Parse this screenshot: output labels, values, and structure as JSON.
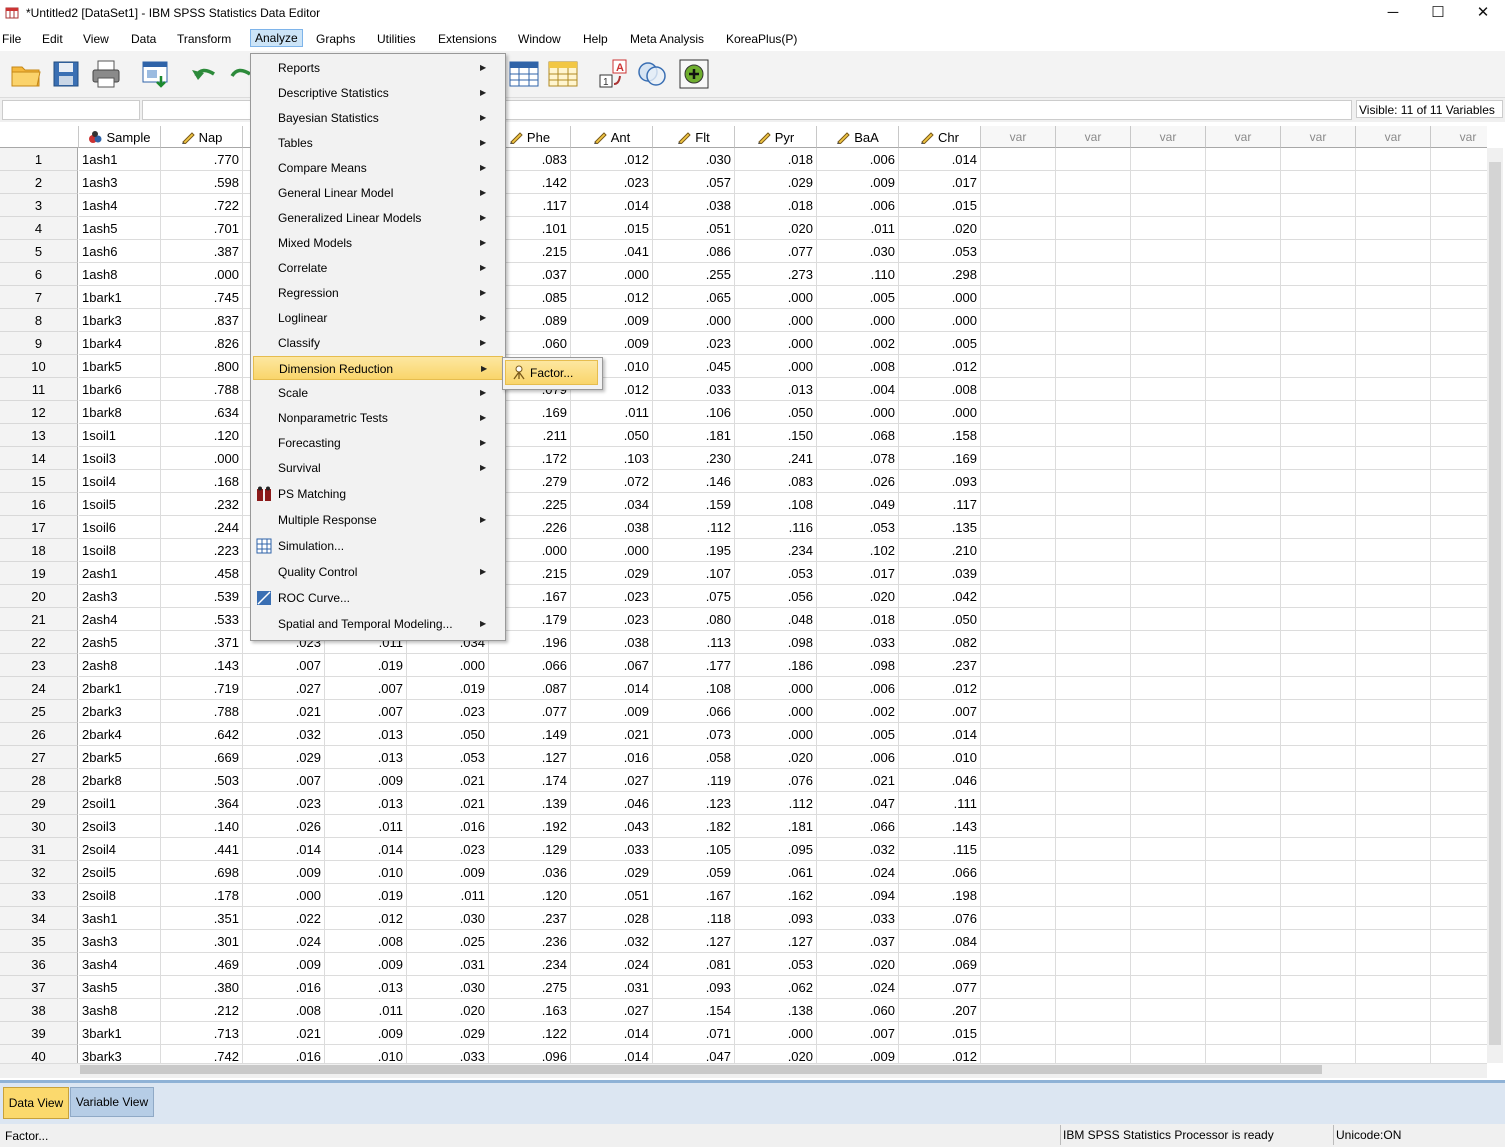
{
  "window": {
    "title": "*Untitled2 [DataSet1] - IBM SPSS Statistics Data Editor",
    "controls": [
      "─",
      "☐",
      "✕"
    ]
  },
  "menubar": [
    "File",
    "Edit",
    "View",
    "Data",
    "Transform",
    "Analyze",
    "Graphs",
    "Utilities",
    "Extensions",
    "Window",
    "Help",
    "Meta Analysis",
    "KoreaPlus(P)"
  ],
  "cellbar": {
    "visible_label": "Visible: 11 of 11 Variables"
  },
  "grid": {
    "columns": [
      "Sample",
      "Nap",
      "",
      "",
      "",
      "Phe",
      "Ant",
      "Flt",
      "Pyr",
      "BaA",
      "Chr"
    ],
    "var_label": "var",
    "rows": [
      [
        "1",
        "1ash1",
        ".770",
        "",
        "",
        "",
        ".083",
        ".012",
        ".030",
        ".018",
        ".006",
        ".014"
      ],
      [
        "2",
        "1ash3",
        ".598",
        "",
        "",
        "",
        ".142",
        ".023",
        ".057",
        ".029",
        ".009",
        ".017"
      ],
      [
        "3",
        "1ash4",
        ".722",
        "",
        "",
        "",
        ".117",
        ".014",
        ".038",
        ".018",
        ".006",
        ".015"
      ],
      [
        "4",
        "1ash5",
        ".701",
        "",
        "",
        "",
        ".101",
        ".015",
        ".051",
        ".020",
        ".011",
        ".020"
      ],
      [
        "5",
        "1ash6",
        ".387",
        "",
        "",
        "",
        ".215",
        ".041",
        ".086",
        ".077",
        ".030",
        ".053"
      ],
      [
        "6",
        "1ash8",
        ".000",
        "",
        "",
        "",
        ".037",
        ".000",
        ".255",
        ".273",
        ".110",
        ".298"
      ],
      [
        "7",
        "1bark1",
        ".745",
        "",
        "",
        "",
        ".085",
        ".012",
        ".065",
        ".000",
        ".005",
        ".000"
      ],
      [
        "8",
        "1bark3",
        ".837",
        "",
        "",
        "",
        ".089",
        ".009",
        ".000",
        ".000",
        ".000",
        ".000"
      ],
      [
        "9",
        "1bark4",
        ".826",
        "",
        "",
        "",
        ".060",
        ".009",
        ".023",
        ".000",
        ".002",
        ".005"
      ],
      [
        "10",
        "1bark5",
        ".800",
        "",
        "",
        "",
        "",
        ".010",
        ".045",
        ".000",
        ".008",
        ".012"
      ],
      [
        "11",
        "1bark6",
        ".788",
        "",
        "",
        "",
        ".079",
        ".012",
        ".033",
        ".013",
        ".004",
        ".008"
      ],
      [
        "12",
        "1bark8",
        ".634",
        "",
        "",
        "",
        ".169",
        ".011",
        ".106",
        ".050",
        ".000",
        ".000"
      ],
      [
        "13",
        "1soil1",
        ".120",
        "",
        "",
        "",
        ".211",
        ".050",
        ".181",
        ".150",
        ".068",
        ".158"
      ],
      [
        "14",
        "1soil3",
        ".000",
        "",
        "",
        "",
        ".172",
        ".103",
        ".230",
        ".241",
        ".078",
        ".169"
      ],
      [
        "15",
        "1soil4",
        ".168",
        "",
        "",
        "",
        ".279",
        ".072",
        ".146",
        ".083",
        ".026",
        ".093"
      ],
      [
        "16",
        "1soil5",
        ".232",
        "",
        "",
        "",
        ".225",
        ".034",
        ".159",
        ".108",
        ".049",
        ".117"
      ],
      [
        "17",
        "1soil6",
        ".244",
        "",
        "",
        "",
        ".226",
        ".038",
        ".112",
        ".116",
        ".053",
        ".135"
      ],
      [
        "18",
        "1soil8",
        ".223",
        "",
        "",
        "",
        ".000",
        ".000",
        ".195",
        ".234",
        ".102",
        ".210"
      ],
      [
        "19",
        "2ash1",
        ".458",
        "",
        "",
        "",
        ".215",
        ".029",
        ".107",
        ".053",
        ".017",
        ".039"
      ],
      [
        "20",
        "2ash3",
        ".539",
        "",
        "",
        "",
        ".167",
        ".023",
        ".075",
        ".056",
        ".020",
        ".042"
      ],
      [
        "21",
        "2ash4",
        ".533",
        "",
        "",
        "",
        ".179",
        ".023",
        ".080",
        ".048",
        ".018",
        ".050"
      ],
      [
        "22",
        "2ash5",
        ".371",
        ".023",
        ".011",
        ".034",
        ".196",
        ".038",
        ".113",
        ".098",
        ".033",
        ".082"
      ],
      [
        "23",
        "2ash8",
        ".143",
        ".007",
        ".019",
        ".000",
        ".066",
        ".067",
        ".177",
        ".186",
        ".098",
        ".237"
      ],
      [
        "24",
        "2bark1",
        ".719",
        ".027",
        ".007",
        ".019",
        ".087",
        ".014",
        ".108",
        ".000",
        ".006",
        ".012"
      ],
      [
        "25",
        "2bark3",
        ".788",
        ".021",
        ".007",
        ".023",
        ".077",
        ".009",
        ".066",
        ".000",
        ".002",
        ".007"
      ],
      [
        "26",
        "2bark4",
        ".642",
        ".032",
        ".013",
        ".050",
        ".149",
        ".021",
        ".073",
        ".000",
        ".005",
        ".014"
      ],
      [
        "27",
        "2bark5",
        ".669",
        ".029",
        ".013",
        ".053",
        ".127",
        ".016",
        ".058",
        ".020",
        ".006",
        ".010"
      ],
      [
        "28",
        "2bark8",
        ".503",
        ".007",
        ".009",
        ".021",
        ".174",
        ".027",
        ".119",
        ".076",
        ".021",
        ".046"
      ],
      [
        "29",
        "2soil1",
        ".364",
        ".023",
        ".013",
        ".021",
        ".139",
        ".046",
        ".123",
        ".112",
        ".047",
        ".111"
      ],
      [
        "30",
        "2soil3",
        ".140",
        ".026",
        ".011",
        ".016",
        ".192",
        ".043",
        ".182",
        ".181",
        ".066",
        ".143"
      ],
      [
        "31",
        "2soil4",
        ".441",
        ".014",
        ".014",
        ".023",
        ".129",
        ".033",
        ".105",
        ".095",
        ".032",
        ".115"
      ],
      [
        "32",
        "2soil5",
        ".698",
        ".009",
        ".010",
        ".009",
        ".036",
        ".029",
        ".059",
        ".061",
        ".024",
        ".066"
      ],
      [
        "33",
        "2soil8",
        ".178",
        ".000",
        ".019",
        ".011",
        ".120",
        ".051",
        ".167",
        ".162",
        ".094",
        ".198"
      ],
      [
        "34",
        "3ash1",
        ".351",
        ".022",
        ".012",
        ".030",
        ".237",
        ".028",
        ".118",
        ".093",
        ".033",
        ".076"
      ],
      [
        "35",
        "3ash3",
        ".301",
        ".024",
        ".008",
        ".025",
        ".236",
        ".032",
        ".127",
        ".127",
        ".037",
        ".084"
      ],
      [
        "36",
        "3ash4",
        ".469",
        ".009",
        ".009",
        ".031",
        ".234",
        ".024",
        ".081",
        ".053",
        ".020",
        ".069"
      ],
      [
        "37",
        "3ash5",
        ".380",
        ".016",
        ".013",
        ".030",
        ".275",
        ".031",
        ".093",
        ".062",
        ".024",
        ".077"
      ],
      [
        "38",
        "3ash8",
        ".212",
        ".008",
        ".011",
        ".020",
        ".163",
        ".027",
        ".154",
        ".138",
        ".060",
        ".207"
      ],
      [
        "39",
        "3bark1",
        ".713",
        ".021",
        ".009",
        ".029",
        ".122",
        ".014",
        ".071",
        ".000",
        ".007",
        ".015"
      ],
      [
        "40",
        "3bark3",
        ".742",
        ".016",
        ".010",
        ".033",
        ".096",
        ".014",
        ".047",
        ".020",
        ".009",
        ".012"
      ]
    ]
  },
  "analyze_menu": [
    {
      "label": "Reports",
      "submenu": true,
      "icon": ""
    },
    {
      "label": "Descriptive Statistics",
      "submenu": true,
      "icon": ""
    },
    {
      "label": "Bayesian Statistics",
      "submenu": true,
      "icon": ""
    },
    {
      "label": "Tables",
      "submenu": true,
      "icon": ""
    },
    {
      "label": "Compare Means",
      "submenu": true,
      "icon": ""
    },
    {
      "label": "General Linear Model",
      "submenu": true,
      "icon": ""
    },
    {
      "label": "Generalized Linear Models",
      "submenu": true,
      "icon": ""
    },
    {
      "label": "Mixed Models",
      "submenu": true,
      "icon": ""
    },
    {
      "label": "Correlate",
      "submenu": true,
      "icon": ""
    },
    {
      "label": "Regression",
      "submenu": true,
      "icon": ""
    },
    {
      "label": "Loglinear",
      "submenu": true,
      "icon": ""
    },
    {
      "label": "Classify",
      "submenu": true,
      "icon": ""
    },
    {
      "label": "Dimension Reduction",
      "submenu": true,
      "icon": "",
      "highlighted": true
    },
    {
      "label": "Scale",
      "submenu": true,
      "icon": ""
    },
    {
      "label": "Nonparametric Tests",
      "submenu": true,
      "icon": ""
    },
    {
      "label": "Forecasting",
      "submenu": true,
      "icon": ""
    },
    {
      "label": "Survival",
      "submenu": true,
      "icon": ""
    },
    {
      "label": "PS Matching",
      "submenu": false,
      "icon": "ps-matching-icon"
    },
    {
      "label": "Multiple Response",
      "submenu": true,
      "icon": ""
    },
    {
      "label": "Simulation...",
      "submenu": false,
      "icon": "simulation-icon"
    },
    {
      "label": "Quality Control",
      "submenu": true,
      "icon": ""
    },
    {
      "label": "ROC Curve...",
      "submenu": false,
      "icon": "roc-curve-icon"
    },
    {
      "label": "Spatial and Temporal Modeling...",
      "submenu": true,
      "icon": ""
    }
  ],
  "factor_submenu": {
    "label": "Factor..."
  },
  "tabs": {
    "data_view": "Data View",
    "variable_view": "Variable View"
  },
  "status": {
    "left": "Factor...",
    "processor": "IBM SPSS Statistics Processor is ready",
    "unicode": "Unicode:ON"
  }
}
